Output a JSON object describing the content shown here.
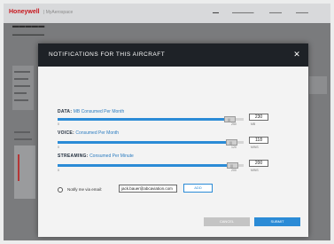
{
  "app": {
    "brand": "Honeywell",
    "brand_sub": "| MyAerospace"
  },
  "modal": {
    "title": "NOTIFICATIONS FOR THIS AIRCRAFT",
    "close_glyph": "✕",
    "sections": [
      {
        "name": "DATA:",
        "desc": "MB Consumed Per Month",
        "min": "0",
        "max": "250",
        "value": "230",
        "unit": "MB",
        "level": 0.92
      },
      {
        "name": "VOICE:",
        "desc": "Consumed Per Month",
        "min": "0",
        "max": "120",
        "value": "118",
        "unit": "MINS",
        "level": 0.98
      },
      {
        "name": "STREAMING:",
        "desc": "Consumed Per Minute",
        "min": "0",
        "max": "200",
        "value": "200",
        "unit": "MINS",
        "level": 1.0
      }
    ],
    "handle_grip": "|||",
    "notify_label": "Notify me via email:",
    "email_value": "jack.bauer@abcaviation.com",
    "add_label": "ADD",
    "cancel_label": "CANCEL",
    "submit_label": "SUBMIT"
  },
  "colors": {
    "accent": "#2b8bd6",
    "header": "#1e2227",
    "brand_red": "#c8161d"
  }
}
